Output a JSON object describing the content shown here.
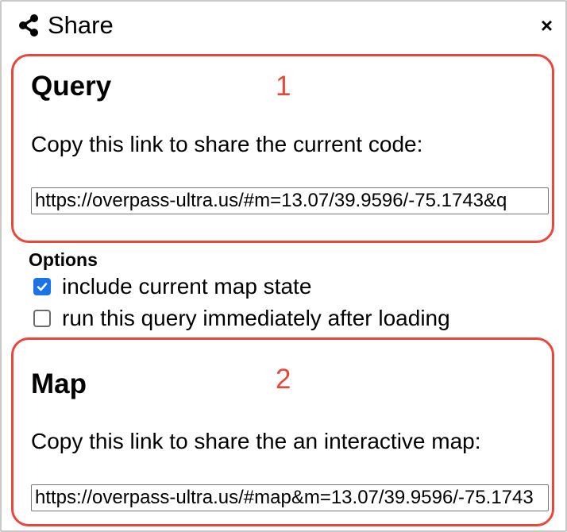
{
  "dialog": {
    "title": "Share",
    "title_icon": "share-icon",
    "close_label": "×"
  },
  "query_section": {
    "title": "Query",
    "number": "1",
    "description": "Copy this link to share the current code:",
    "link": "https://overpass-ultra.us/#m=13.07/39.9596/-75.1743&q"
  },
  "options": {
    "title": "Options",
    "items": [
      {
        "label": "include current map state",
        "checked": true
      },
      {
        "label": "run this query immediately after loading",
        "checked": false
      }
    ]
  },
  "map_section": {
    "title": "Map",
    "number": "2",
    "description": "Copy this link to share the an interactive map:",
    "link": "https://overpass-ultra.us/#map&m=13.07/39.9596/-75.1743"
  },
  "colors": {
    "highlight": "#e8473a",
    "checkbox": "#1a73e8"
  }
}
